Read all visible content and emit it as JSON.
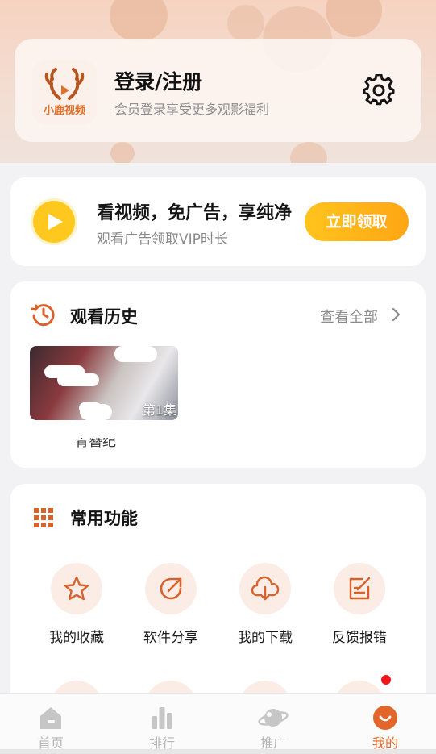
{
  "header": {
    "logo_text": "小鹿视频",
    "login_title": "登录/注册",
    "login_subtitle": "会员登录享受更多观影福利"
  },
  "vip_promo": {
    "title": "看视频，免广告，享纯净",
    "subtitle": "观看广告领取VIP时长",
    "button_label": "立即领取"
  },
  "history": {
    "title": "观看历史",
    "see_all_label": "查看全部",
    "items": [
      {
        "episode": "第1集",
        "title": "青簪纪"
      }
    ]
  },
  "functions": {
    "title": "常用功能",
    "items": [
      {
        "label": "我的收藏",
        "icon": "star-icon"
      },
      {
        "label": "软件分享",
        "icon": "share-icon"
      },
      {
        "label": "我的下载",
        "icon": "cloud-download-icon"
      },
      {
        "label": "反馈报错",
        "icon": "feedback-icon"
      }
    ]
  },
  "tabbar": {
    "tabs": [
      {
        "label": "首页",
        "icon": "home-icon"
      },
      {
        "label": "排行",
        "icon": "ranking-icon"
      },
      {
        "label": "推广",
        "icon": "planet-icon"
      },
      {
        "label": "我的",
        "icon": "profile-icon",
        "active": true
      }
    ]
  },
  "colors": {
    "accent": "#e2662a",
    "vip_button": "#ffb317",
    "notification_dot": "#f4161b"
  }
}
